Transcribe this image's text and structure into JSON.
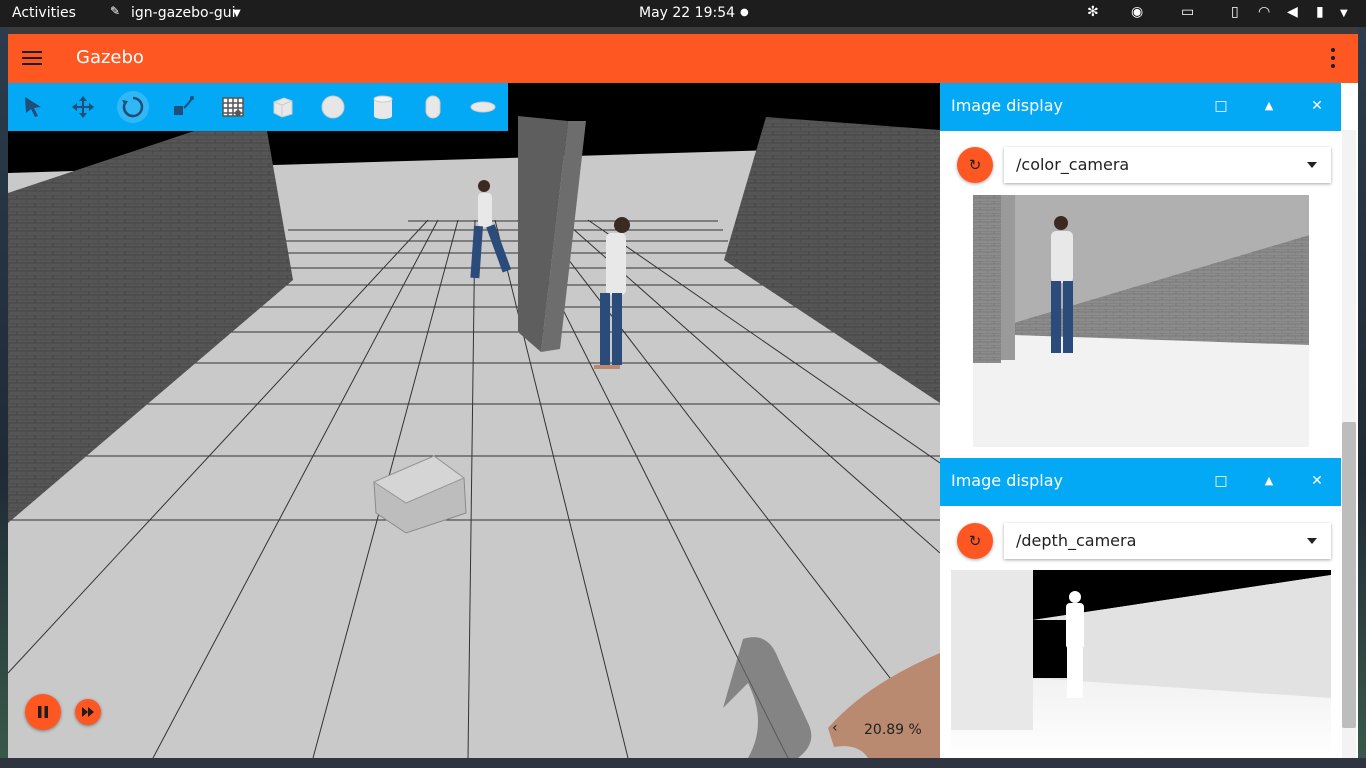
{
  "topbar": {
    "activities": "Activities",
    "app_menu": "ign-gazebo-gui",
    "datetime": "May 22  19:54",
    "dot": "●"
  },
  "app": {
    "title": "Gazebo"
  },
  "toolbar": {
    "tools": [
      "select",
      "translate",
      "rotate",
      "transform-control",
      "grid",
      "box",
      "sphere",
      "cylinder",
      "capsule",
      "ellipsoid"
    ],
    "active_tool": "rotate"
  },
  "playback": {
    "rtf": "20.89 %",
    "rtf_arrow": "‹"
  },
  "panels": [
    {
      "title": "Image display",
      "topic": "/color_camera",
      "refresh_icon": "↻",
      "btn_max": "□",
      "btn_up": "▲",
      "btn_close": "✕"
    },
    {
      "title": "Image display",
      "topic": "/depth_camera",
      "refresh_icon": "↻",
      "btn_max": "□",
      "btn_up": "▲",
      "btn_close": "✕"
    }
  ],
  "colors": {
    "appbar": "#ff5722",
    "toolbar": "#03a9f4",
    "accent": "#ff5722"
  }
}
